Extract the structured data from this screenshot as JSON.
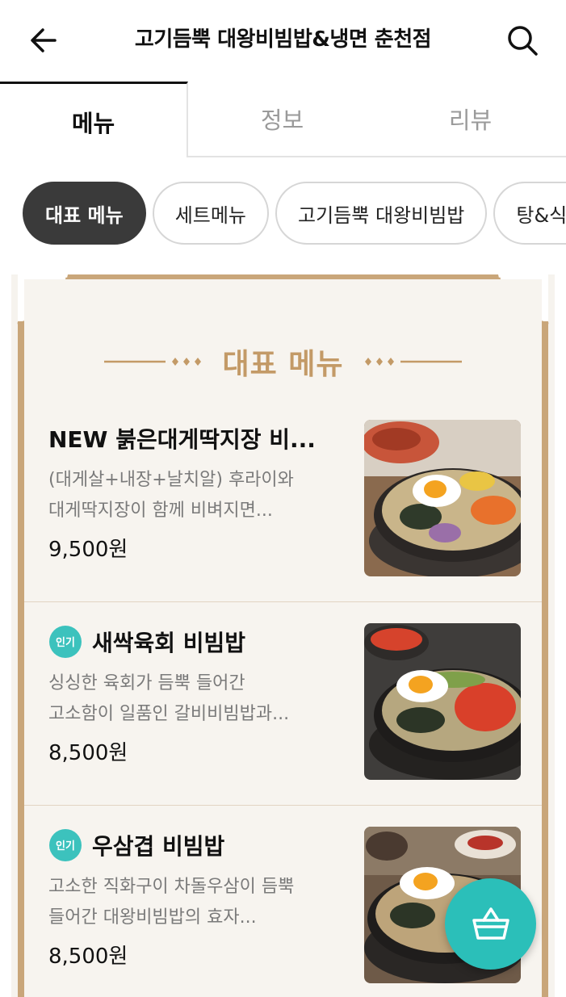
{
  "header": {
    "title": "고기듬뿍 대왕비빔밥&냉면 춘천점",
    "back_icon": "arrow-left-icon",
    "search_icon": "search-icon"
  },
  "tabs": [
    {
      "label": "메뉴",
      "active": true
    },
    {
      "label": "정보",
      "active": false
    },
    {
      "label": "리뷰",
      "active": false
    }
  ],
  "categories": [
    {
      "label": "대표 메뉴",
      "active": true
    },
    {
      "label": "세트메뉴",
      "active": false
    },
    {
      "label": "고기듬뿍 대왕비빔밥",
      "active": false
    },
    {
      "label": "탕&식사",
      "active": false
    }
  ],
  "section": {
    "title": "대표 메뉴",
    "accent_color": "#c39a67"
  },
  "menu_items": [
    {
      "name": "NEW 붉은대게딱지장 비...",
      "badge": "",
      "desc_line1": "(대게살+내장+날치알) 후라이와",
      "desc_line2": "대게딱지장이 함께 비벼지면...",
      "price": "9,500원"
    },
    {
      "name": "새싹육회 비빔밥",
      "badge": "인기",
      "desc_line1": "싱싱한 육회가 듬뿍 들어간",
      "desc_line2": "고소함이 일품인 갈비비빔밥과...",
      "price": "8,500원"
    },
    {
      "name": "우삼겹 비빔밥",
      "badge": "인기",
      "desc_line1": "고소한 직화구이 차돌우삼이 듬뿍",
      "desc_line2": "들어간 대왕비빔밥의 효자...",
      "price": "8,500원"
    }
  ],
  "cart": {
    "icon": "basket-icon",
    "color": "#2bbfb9"
  }
}
